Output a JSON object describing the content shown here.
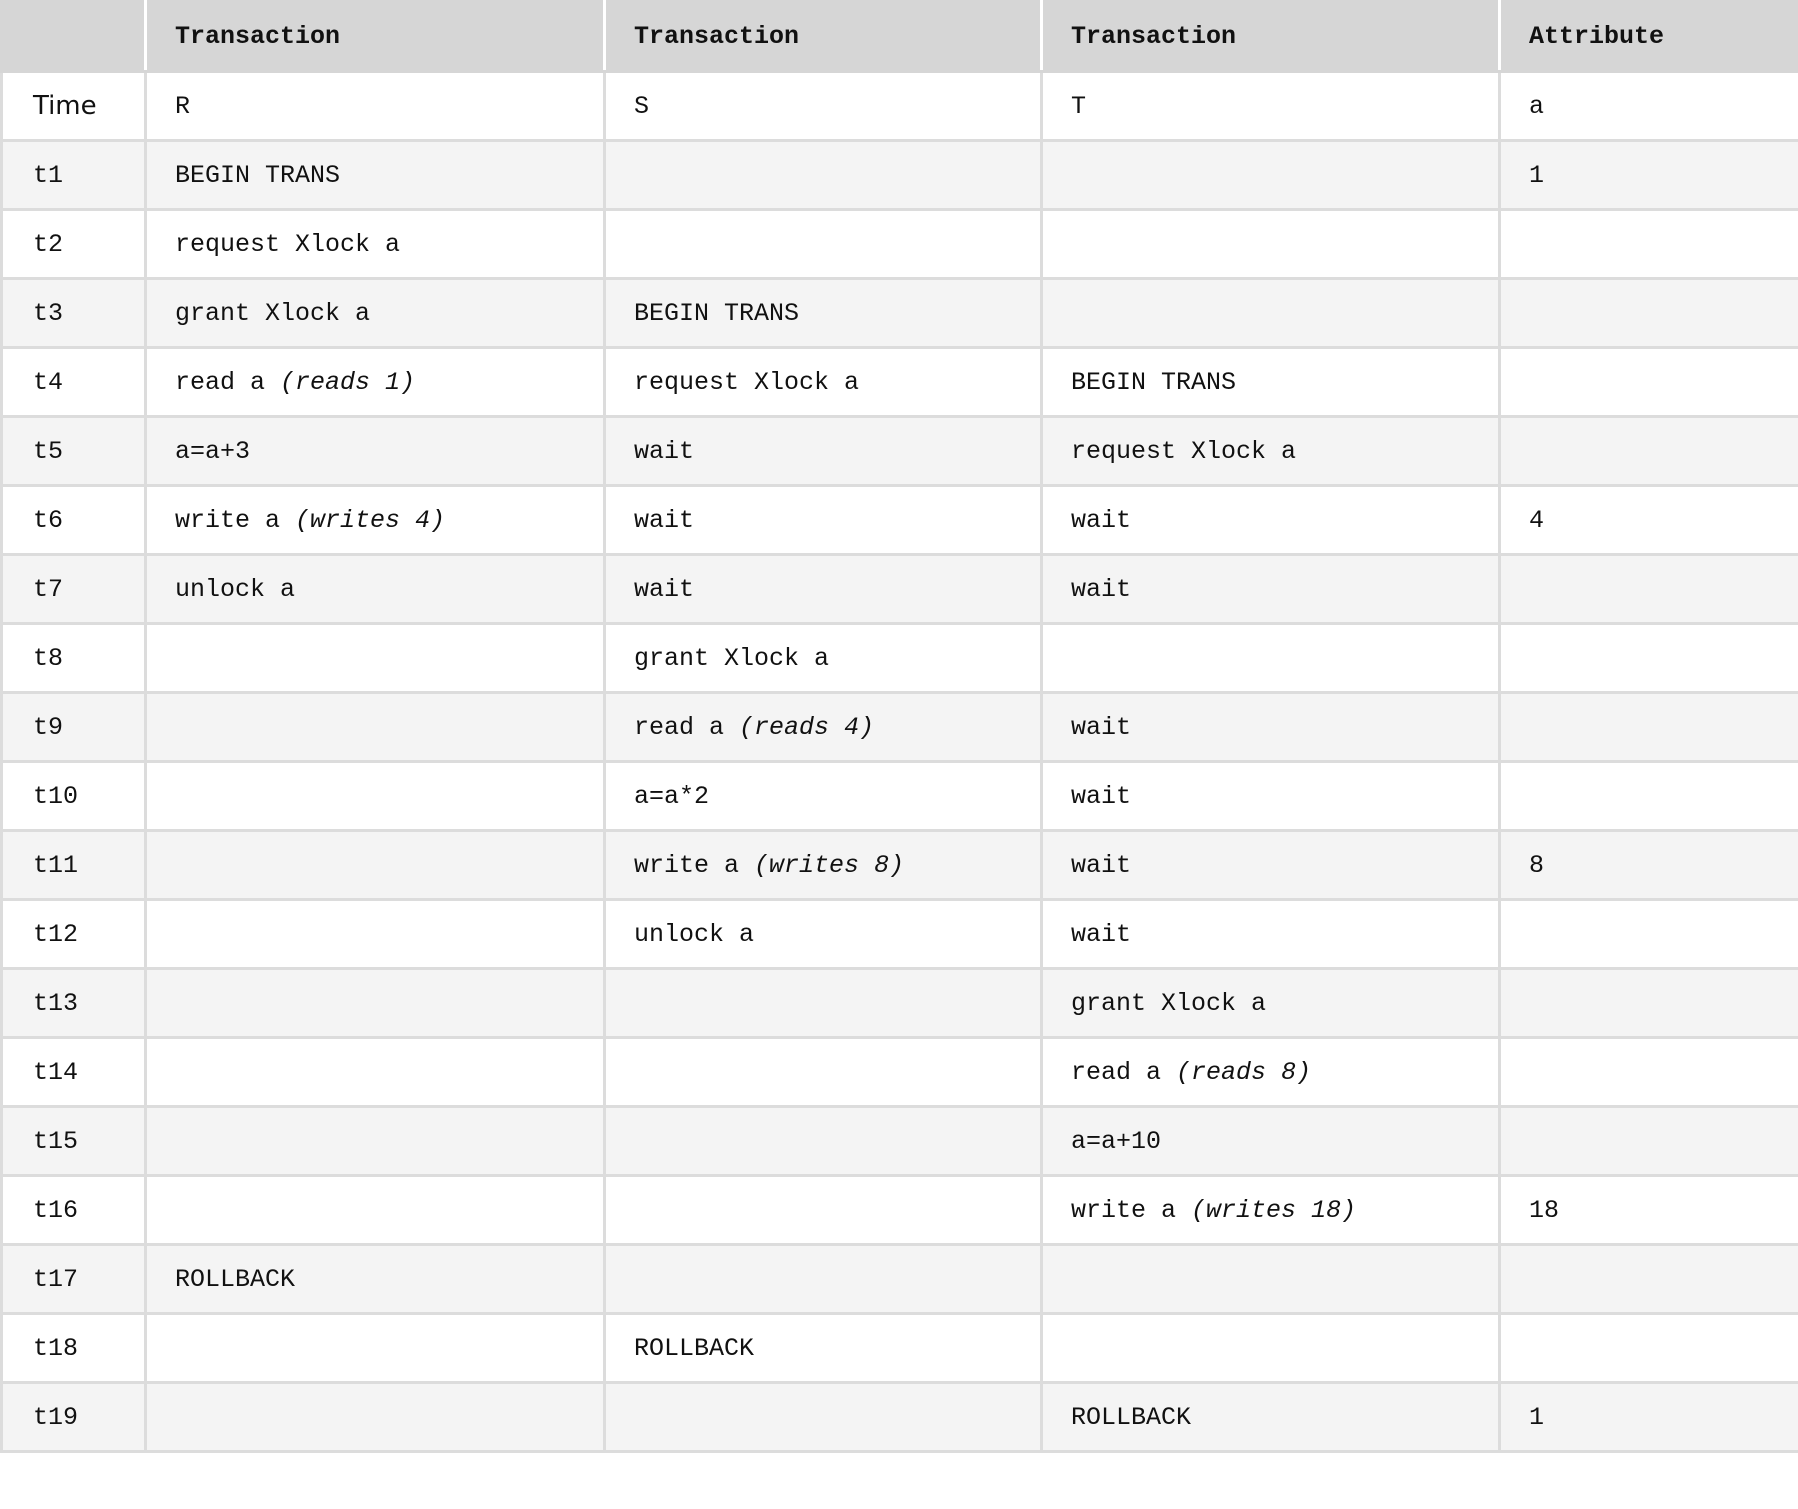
{
  "table": {
    "headers": [
      "",
      "Transaction",
      "Transaction",
      "Transaction",
      "Attribute"
    ],
    "subheader": {
      "time_label": "Time",
      "transactions": [
        "R",
        "S",
        "T"
      ],
      "attribute": "a"
    },
    "rows": [
      {
        "time": "t1",
        "R": {
          "text": "BEGIN TRANS",
          "note": ""
        },
        "S": {
          "text": "",
          "note": ""
        },
        "T": {
          "text": "",
          "note": ""
        },
        "a": "1"
      },
      {
        "time": "t2",
        "R": {
          "text": "request Xlock a",
          "note": ""
        },
        "S": {
          "text": "",
          "note": ""
        },
        "T": {
          "text": "",
          "note": ""
        },
        "a": ""
      },
      {
        "time": "t3",
        "R": {
          "text": "grant Xlock a",
          "note": ""
        },
        "S": {
          "text": "BEGIN TRANS",
          "note": ""
        },
        "T": {
          "text": "",
          "note": ""
        },
        "a": ""
      },
      {
        "time": "t4",
        "R": {
          "text": "read a ",
          "note": "(reads 1)"
        },
        "S": {
          "text": "request Xlock a",
          "note": ""
        },
        "T": {
          "text": "BEGIN TRANS",
          "note": ""
        },
        "a": ""
      },
      {
        "time": "t5",
        "R": {
          "text": "a=a+3",
          "note": ""
        },
        "S": {
          "text": "wait",
          "note": ""
        },
        "T": {
          "text": "request Xlock a",
          "note": ""
        },
        "a": ""
      },
      {
        "time": "t6",
        "R": {
          "text": "write a ",
          "note": "(writes 4)"
        },
        "S": {
          "text": "wait",
          "note": ""
        },
        "T": {
          "text": "wait",
          "note": ""
        },
        "a": "4"
      },
      {
        "time": "t7",
        "R": {
          "text": "unlock a",
          "note": ""
        },
        "S": {
          "text": "wait",
          "note": ""
        },
        "T": {
          "text": "wait",
          "note": ""
        },
        "a": ""
      },
      {
        "time": "t8",
        "R": {
          "text": "",
          "note": ""
        },
        "S": {
          "text": "grant Xlock a",
          "note": ""
        },
        "T": {
          "text": "",
          "note": ""
        },
        "a": ""
      },
      {
        "time": "t9",
        "R": {
          "text": "",
          "note": ""
        },
        "S": {
          "text": "read a ",
          "note": "(reads 4)"
        },
        "T": {
          "text": "wait",
          "note": ""
        },
        "a": ""
      },
      {
        "time": "t10",
        "R": {
          "text": "",
          "note": ""
        },
        "S": {
          "text": "a=a*2",
          "note": ""
        },
        "T": {
          "text": "wait",
          "note": ""
        },
        "a": ""
      },
      {
        "time": "t11",
        "R": {
          "text": "",
          "note": ""
        },
        "S": {
          "text": "write a ",
          "note": "(writes 8)"
        },
        "T": {
          "text": "wait",
          "note": ""
        },
        "a": "8"
      },
      {
        "time": "t12",
        "R": {
          "text": "",
          "note": ""
        },
        "S": {
          "text": "unlock a",
          "note": ""
        },
        "T": {
          "text": "wait",
          "note": ""
        },
        "a": ""
      },
      {
        "time": "t13",
        "R": {
          "text": "",
          "note": ""
        },
        "S": {
          "text": "",
          "note": ""
        },
        "T": {
          "text": "grant Xlock a",
          "note": ""
        },
        "a": ""
      },
      {
        "time": "t14",
        "R": {
          "text": "",
          "note": ""
        },
        "S": {
          "text": "",
          "note": ""
        },
        "T": {
          "text": "read a ",
          "note": "(reads 8)"
        },
        "a": ""
      },
      {
        "time": "t15",
        "R": {
          "text": "",
          "note": ""
        },
        "S": {
          "text": "",
          "note": ""
        },
        "T": {
          "text": "a=a+10",
          "note": ""
        },
        "a": ""
      },
      {
        "time": "t16",
        "R": {
          "text": "",
          "note": ""
        },
        "S": {
          "text": "",
          "note": ""
        },
        "T": {
          "text": "write a ",
          "note": "(writes 18)"
        },
        "a": "18"
      },
      {
        "time": "t17",
        "R": {
          "text": "ROLLBACK",
          "note": ""
        },
        "S": {
          "text": "",
          "note": ""
        },
        "T": {
          "text": "",
          "note": ""
        },
        "a": ""
      },
      {
        "time": "t18",
        "R": {
          "text": "",
          "note": ""
        },
        "S": {
          "text": "ROLLBACK",
          "note": ""
        },
        "T": {
          "text": "",
          "note": ""
        },
        "a": ""
      },
      {
        "time": "t19",
        "R": {
          "text": "",
          "note": ""
        },
        "S": {
          "text": "",
          "note": ""
        },
        "T": {
          "text": "ROLLBACK",
          "note": ""
        },
        "a": "1"
      }
    ]
  },
  "colors": {
    "header_bg": "#d6d6d6",
    "row_alt_bg": "#f4f4f4",
    "row_bg": "#ffffff",
    "border": "#dcdcdc"
  }
}
